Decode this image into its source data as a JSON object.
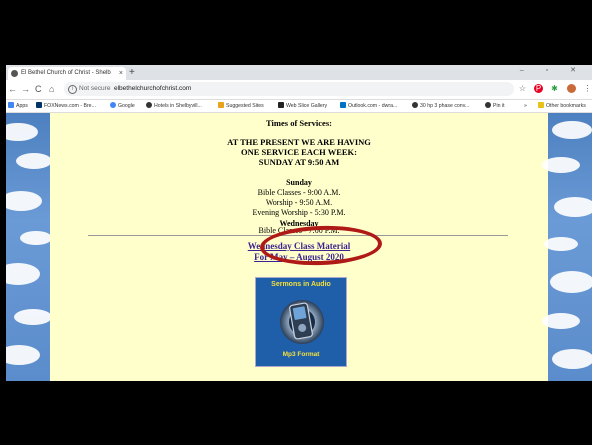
{
  "browser": {
    "tab_title": "El Bethel Church of Christ - Shelb",
    "tab_close": "×",
    "new_tab": "+",
    "window_controls": "– ▫ ✕",
    "security_label": "Not secure",
    "url": "elbethelchurchofchrist.com",
    "nav": {
      "back": "←",
      "forward": "→",
      "reload": "C",
      "home": "⌂"
    },
    "bookmarks": [
      {
        "label": "Apps",
        "color": "#4285f4"
      },
      {
        "label": "FOXNews.com - Bre...",
        "color": "#003366"
      },
      {
        "label": "Google",
        "color": "#4285f4"
      },
      {
        "label": "Hotels in Shelbyvill...",
        "color": "#333333"
      },
      {
        "label": "Suggested Sites",
        "color": "#e8a21b"
      },
      {
        "label": "Web Slice Gallery",
        "color": "#222222"
      },
      {
        "label": "Outlook.com - dwra...",
        "color": "#0072c6"
      },
      {
        "label": "30 hp 3 phase conv...",
        "color": "#333333"
      },
      {
        "label": "Pin it",
        "color": "#333333"
      },
      {
        "label": "»",
        "color": "#ffffff"
      },
      {
        "label": "Other bookmarks",
        "color": "#e8c21b"
      }
    ]
  },
  "page": {
    "heading": "Times of Services:",
    "notice_line1": "AT THE PRESENT WE ARE HAVING",
    "notice_line2": "ONE SERVICE EACH WEEK:",
    "notice_line3": "SUNDAY AT 9:50 AM",
    "sunday_label": "Sunday",
    "sunday_bible": "Bible Classes - 9:00 A.M.",
    "sunday_worship": "Worship - 9:50 A.M.",
    "sunday_evening": "Evening Worship - 5:30 P.M.",
    "wednesday_label": "Wednesday",
    "wednesday_bible": "Bible Classes - 7:00 P.M.",
    "class_link_line1": "Wednesday Class Material",
    "class_link_line2": "For May – August 2020",
    "sermons_title": "Sermons in Audio",
    "sermons_format": "Mp3 Format"
  },
  "colors": {
    "annotation_circle": "#b01a16",
    "page_background": "#ffffcc",
    "link": "#3a238f"
  }
}
